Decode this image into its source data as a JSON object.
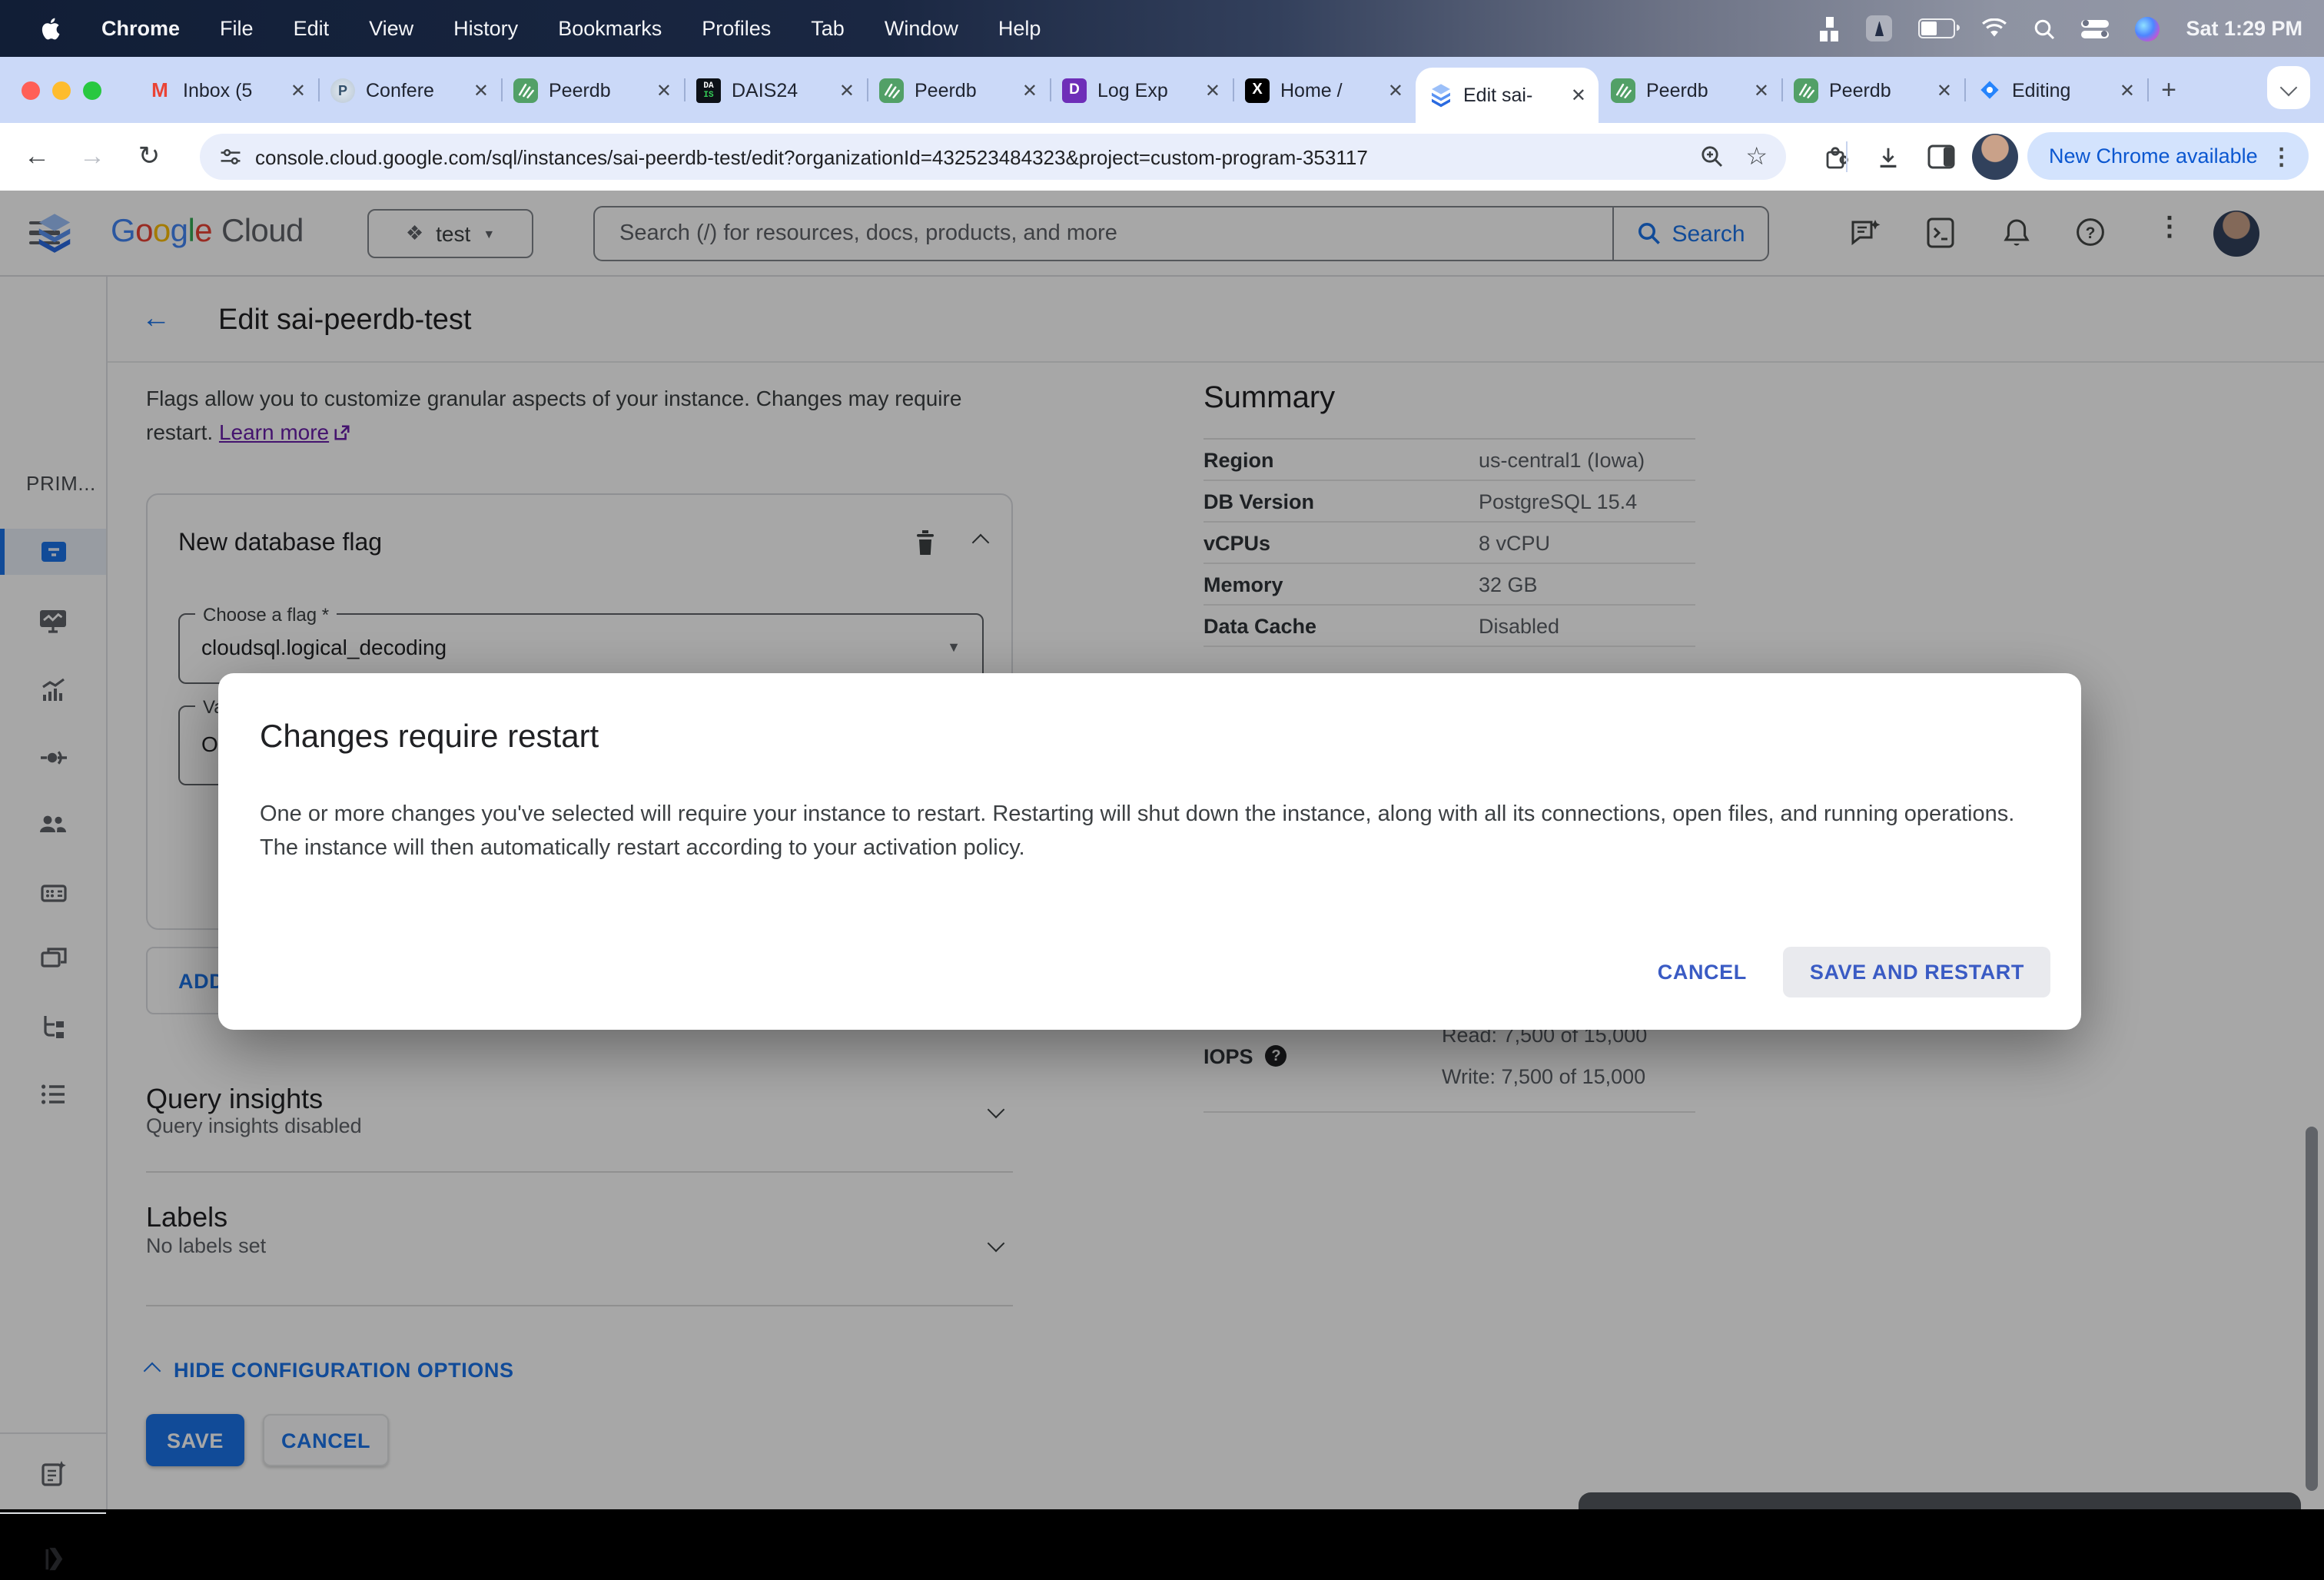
{
  "menubar": {
    "items": [
      "Chrome",
      "File",
      "Edit",
      "View",
      "History",
      "Bookmarks",
      "Profiles",
      "Tab",
      "Window",
      "Help"
    ],
    "clock": "Sat 1:29 PM"
  },
  "tabs": [
    {
      "label": "Inbox (5"
    },
    {
      "label": "Confere"
    },
    {
      "label": "Peerdb"
    },
    {
      "label": "DAIS24"
    },
    {
      "label": "Peerdb"
    },
    {
      "label": "Log Exp"
    },
    {
      "label": "Home /"
    },
    {
      "label": "Edit sai-",
      "active": true
    },
    {
      "label": "Peerdb"
    },
    {
      "label": "Peerdb"
    },
    {
      "label": "Editing"
    }
  ],
  "toolbar": {
    "url": "console.cloud.google.com/sql/instances/sai-peerdb-test/edit?organizationId=432523484323&project=custom-program-353117",
    "new_chrome": "New Chrome available"
  },
  "gcp": {
    "logo_cloud": "Cloud",
    "project": "test",
    "search_placeholder": "Search (/) for resources, docs, products, and more",
    "search_button": "Search"
  },
  "page": {
    "title": "Edit sai-peerdb-test",
    "nav_section": "PRIM..."
  },
  "intro": {
    "text": "Flags allow you to customize granular aspects of your instance. Changes may require restart.",
    "link": "Learn more"
  },
  "flag_card": {
    "title": "New database flag",
    "flag_label": "Choose a flag *",
    "flag_value": "cloudsql.logical_decoding",
    "value_label": "Value *",
    "value_value": "On",
    "add_button": "ADD"
  },
  "summary": {
    "title": "Summary",
    "rows": [
      {
        "label": "Region",
        "value": "us-central1 (Iowa)"
      },
      {
        "label": "DB Version",
        "value": "PostgreSQL 15.4"
      },
      {
        "label": "vCPUs",
        "value": "8 vCPU"
      },
      {
        "label": "Memory",
        "value": "32 GB"
      },
      {
        "label": "Data Cache",
        "value": "Disabled"
      }
    ],
    "iops_label": "IOPS",
    "iops_read": "Read: 7,500 of 15,000",
    "iops_write": "Write: 7,500 of 15,000"
  },
  "modal": {
    "title": "Changes require restart",
    "body": "One or more changes you've selected will require your instance to restart. Restarting will shut down the instance, along with all its connections, open files, and running operations. The instance will then automatically restart according to your activation policy.",
    "cancel": "CANCEL",
    "confirm": "SAVE AND RESTART"
  },
  "sections": {
    "query_title": "Query insights",
    "query_sub": "Query insights disabled",
    "labels_title": "Labels",
    "labels_sub": "No labels set"
  },
  "footer": {
    "hide": "HIDE CONFIGURATION OPTIONS",
    "save": "SAVE",
    "cancel": "CANCEL"
  },
  "colors": {
    "accent_blue": "#1a73e8",
    "dialog_blue": "#3a5bc4",
    "link_purple": "#681da8"
  }
}
